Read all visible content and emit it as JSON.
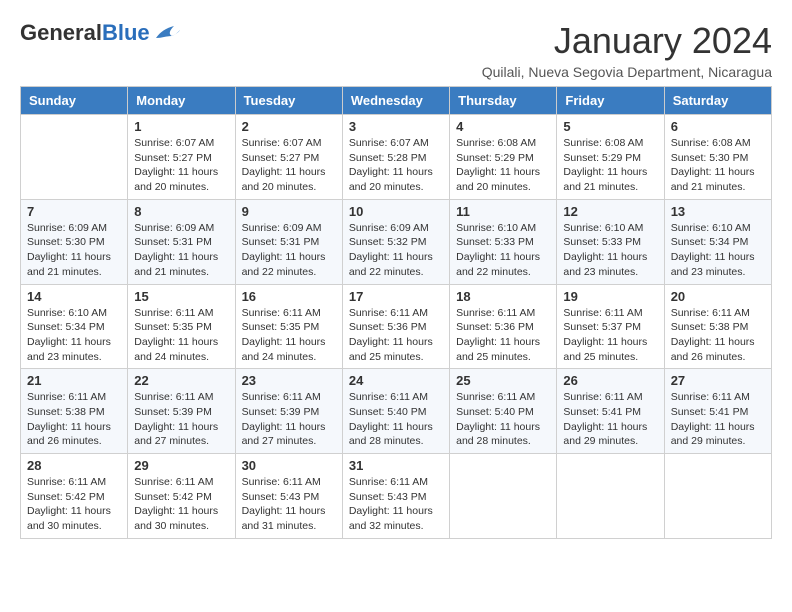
{
  "app": {
    "logo_general": "General",
    "logo_blue": "Blue"
  },
  "header": {
    "month": "January 2024",
    "location": "Quilali, Nueva Segovia Department, Nicaragua"
  },
  "columns": [
    "Sunday",
    "Monday",
    "Tuesday",
    "Wednesday",
    "Thursday",
    "Friday",
    "Saturday"
  ],
  "weeks": [
    [
      {
        "day": "",
        "info": ""
      },
      {
        "day": "1",
        "info": "Sunrise: 6:07 AM\nSunset: 5:27 PM\nDaylight: 11 hours\nand 20 minutes."
      },
      {
        "day": "2",
        "info": "Sunrise: 6:07 AM\nSunset: 5:27 PM\nDaylight: 11 hours\nand 20 minutes."
      },
      {
        "day": "3",
        "info": "Sunrise: 6:07 AM\nSunset: 5:28 PM\nDaylight: 11 hours\nand 20 minutes."
      },
      {
        "day": "4",
        "info": "Sunrise: 6:08 AM\nSunset: 5:29 PM\nDaylight: 11 hours\nand 20 minutes."
      },
      {
        "day": "5",
        "info": "Sunrise: 6:08 AM\nSunset: 5:29 PM\nDaylight: 11 hours\nand 21 minutes."
      },
      {
        "day": "6",
        "info": "Sunrise: 6:08 AM\nSunset: 5:30 PM\nDaylight: 11 hours\nand 21 minutes."
      }
    ],
    [
      {
        "day": "7",
        "info": "Sunrise: 6:09 AM\nSunset: 5:30 PM\nDaylight: 11 hours\nand 21 minutes."
      },
      {
        "day": "8",
        "info": "Sunrise: 6:09 AM\nSunset: 5:31 PM\nDaylight: 11 hours\nand 21 minutes."
      },
      {
        "day": "9",
        "info": "Sunrise: 6:09 AM\nSunset: 5:31 PM\nDaylight: 11 hours\nand 22 minutes."
      },
      {
        "day": "10",
        "info": "Sunrise: 6:09 AM\nSunset: 5:32 PM\nDaylight: 11 hours\nand 22 minutes."
      },
      {
        "day": "11",
        "info": "Sunrise: 6:10 AM\nSunset: 5:33 PM\nDaylight: 11 hours\nand 22 minutes."
      },
      {
        "day": "12",
        "info": "Sunrise: 6:10 AM\nSunset: 5:33 PM\nDaylight: 11 hours\nand 23 minutes."
      },
      {
        "day": "13",
        "info": "Sunrise: 6:10 AM\nSunset: 5:34 PM\nDaylight: 11 hours\nand 23 minutes."
      }
    ],
    [
      {
        "day": "14",
        "info": "Sunrise: 6:10 AM\nSunset: 5:34 PM\nDaylight: 11 hours\nand 23 minutes."
      },
      {
        "day": "15",
        "info": "Sunrise: 6:11 AM\nSunset: 5:35 PM\nDaylight: 11 hours\nand 24 minutes."
      },
      {
        "day": "16",
        "info": "Sunrise: 6:11 AM\nSunset: 5:35 PM\nDaylight: 11 hours\nand 24 minutes."
      },
      {
        "day": "17",
        "info": "Sunrise: 6:11 AM\nSunset: 5:36 PM\nDaylight: 11 hours\nand 25 minutes."
      },
      {
        "day": "18",
        "info": "Sunrise: 6:11 AM\nSunset: 5:36 PM\nDaylight: 11 hours\nand 25 minutes."
      },
      {
        "day": "19",
        "info": "Sunrise: 6:11 AM\nSunset: 5:37 PM\nDaylight: 11 hours\nand 25 minutes."
      },
      {
        "day": "20",
        "info": "Sunrise: 6:11 AM\nSunset: 5:38 PM\nDaylight: 11 hours\nand 26 minutes."
      }
    ],
    [
      {
        "day": "21",
        "info": "Sunrise: 6:11 AM\nSunset: 5:38 PM\nDaylight: 11 hours\nand 26 minutes."
      },
      {
        "day": "22",
        "info": "Sunrise: 6:11 AM\nSunset: 5:39 PM\nDaylight: 11 hours\nand 27 minutes."
      },
      {
        "day": "23",
        "info": "Sunrise: 6:11 AM\nSunset: 5:39 PM\nDaylight: 11 hours\nand 27 minutes."
      },
      {
        "day": "24",
        "info": "Sunrise: 6:11 AM\nSunset: 5:40 PM\nDaylight: 11 hours\nand 28 minutes."
      },
      {
        "day": "25",
        "info": "Sunrise: 6:11 AM\nSunset: 5:40 PM\nDaylight: 11 hours\nand 28 minutes."
      },
      {
        "day": "26",
        "info": "Sunrise: 6:11 AM\nSunset: 5:41 PM\nDaylight: 11 hours\nand 29 minutes."
      },
      {
        "day": "27",
        "info": "Sunrise: 6:11 AM\nSunset: 5:41 PM\nDaylight: 11 hours\nand 29 minutes."
      }
    ],
    [
      {
        "day": "28",
        "info": "Sunrise: 6:11 AM\nSunset: 5:42 PM\nDaylight: 11 hours\nand 30 minutes."
      },
      {
        "day": "29",
        "info": "Sunrise: 6:11 AM\nSunset: 5:42 PM\nDaylight: 11 hours\nand 30 minutes."
      },
      {
        "day": "30",
        "info": "Sunrise: 6:11 AM\nSunset: 5:43 PM\nDaylight: 11 hours\nand 31 minutes."
      },
      {
        "day": "31",
        "info": "Sunrise: 6:11 AM\nSunset: 5:43 PM\nDaylight: 11 hours\nand 32 minutes."
      },
      {
        "day": "",
        "info": ""
      },
      {
        "day": "",
        "info": ""
      },
      {
        "day": "",
        "info": ""
      }
    ]
  ]
}
